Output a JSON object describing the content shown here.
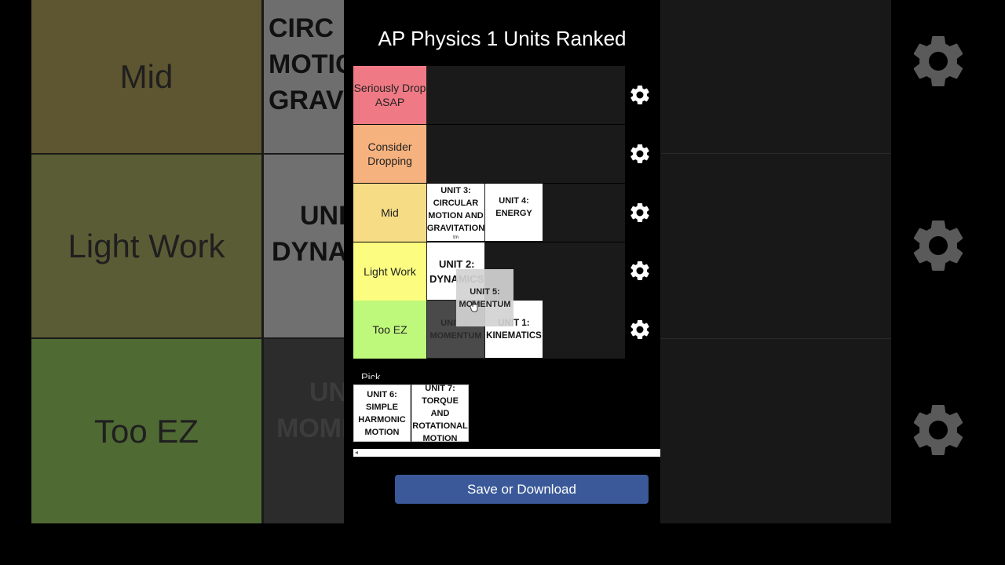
{
  "background": {
    "tiers": [
      {
        "label": "Mid",
        "color": "#5e5531"
      },
      {
        "label": "Light Work",
        "color": "#5a5c35"
      },
      {
        "label": "Too EZ",
        "color": "#4f6a33"
      }
    ],
    "tiles": [
      {
        "lines": [
          "CIRC",
          "MOTIC",
          "GRAVI"
        ]
      },
      {
        "lines": [
          "",
          "UNI",
          "DYNA"
        ]
      },
      {
        "lines": [
          "UN",
          "MOMI"
        ]
      }
    ]
  },
  "app": {
    "title": "AP Physics 1 Units Ranked"
  },
  "tiers": [
    {
      "label": "Seriously Drop ASAP",
      "color": "#ef7a85",
      "gear_icon": "gear-icon"
    },
    {
      "label": "Consider Dropping",
      "color": "#f5b27e",
      "gear_icon": "gear-icon"
    },
    {
      "label": "Mid",
      "color": "#f6dd85",
      "gear_icon": "gear-icon"
    },
    {
      "label": "Light Work",
      "color": "#fcfd80",
      "gear_icon": "gear-icon"
    },
    {
      "label": "Too EZ",
      "color": "#bff97b",
      "gear_icon": "gear-icon"
    }
  ],
  "cards": {
    "unit3": {
      "title": "UNIT 3: CIRCULAR MOTION AND GRAVITATION",
      "sub": "tm"
    },
    "unit4": {
      "title": "UNIT 4: ENERGY"
    },
    "unit2": {
      "line1": "UNIT 2:",
      "line2": "DYNAMICS"
    },
    "unit5_drag": {
      "line1": "UNIT 5:",
      "line2": "MOMENTUM"
    },
    "unit5_ghost": {
      "line1": "UNIT 5:",
      "line2": "MOMENTUM"
    },
    "unit1": {
      "line1": "UNIT 1:",
      "line2": "KINEMATICS"
    },
    "unit6": {
      "title": "UNIT 6: SIMPLE HARMONIC MOTION"
    },
    "unit7": {
      "title": "UNIT 7: TORQUE AND ROTATIONAL MOTION"
    }
  },
  "pool": {
    "label": "Pick"
  },
  "actions": {
    "save_label": "Save or Download",
    "save_color": "#3b5998"
  }
}
